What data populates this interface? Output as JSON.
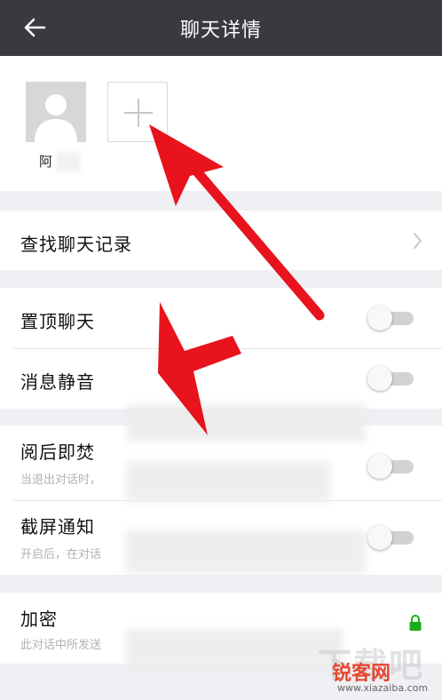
{
  "header": {
    "title": "聊天详情",
    "back_icon": "arrow-left-icon"
  },
  "members": {
    "items": [
      {
        "name": "阿"
      }
    ],
    "add_icon": "plus-icon"
  },
  "search_history": {
    "label": "查找聊天记录",
    "icon": "chevron-right-icon"
  },
  "settings_group1": [
    {
      "label": "置顶聊天",
      "on": false
    },
    {
      "label": "消息静音",
      "on": false
    }
  ],
  "settings_group2": [
    {
      "label": "阅后即焚",
      "sub": "当退出对话时，",
      "on": false
    },
    {
      "label": "截屏通知",
      "sub": "开启后，在对话",
      "on": false
    }
  ],
  "encryption": {
    "label": "加密",
    "sub": "此对话中所发送",
    "icon": "lock-icon",
    "lock_color": "#1aad19"
  },
  "watermark": {
    "big": "下载吧",
    "brand": "锐客网",
    "url": "www.xiazaiba.com"
  },
  "colors": {
    "header_bg": "#393a3f",
    "arrow_red": "#e8131c",
    "background": "#efeff4"
  }
}
